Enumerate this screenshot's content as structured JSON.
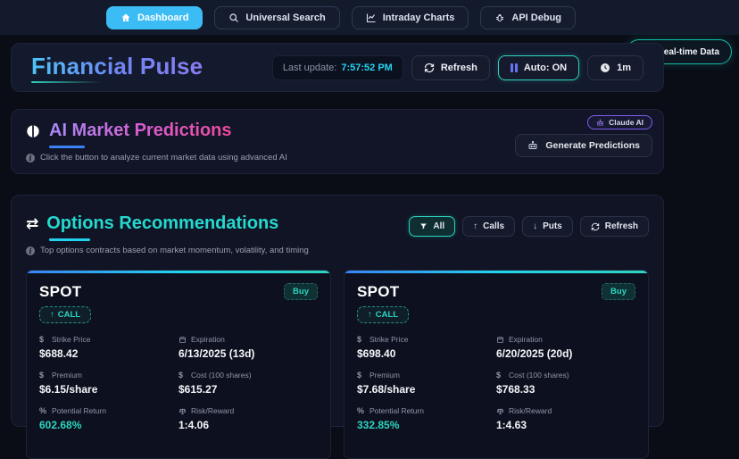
{
  "colors": {
    "accent_sky": "#3cbcf5",
    "accent_teal": "#2dd4bf",
    "accent_cyan": "#22d3ee",
    "accent_blue": "#3b82f6",
    "accent_purple": "#8b5cf6",
    "accent_pink": "#ec4899"
  },
  "navbar": {
    "items": [
      {
        "label": "Dashboard",
        "icon": "home-icon",
        "active": true
      },
      {
        "label": "Universal Search",
        "icon": "search-icon",
        "active": false
      },
      {
        "label": "Intraday Charts",
        "icon": "chart-line-icon",
        "active": false
      },
      {
        "label": "API Debug",
        "icon": "bug-icon",
        "active": false
      }
    ]
  },
  "realtime_badge": {
    "label": "Real-time Data",
    "icon": "check-circle-icon"
  },
  "header": {
    "title": "Financial Pulse",
    "last_update": {
      "label": "Last update:",
      "time": "7:57:52 PM"
    },
    "buttons": {
      "refresh": "Refresh",
      "auto": "Auto: ON",
      "interval": "1m"
    }
  },
  "ai_predictions": {
    "title": "AI Market Predictions",
    "subtitle": "Click the button to analyze current market data using advanced AI",
    "provider_badge": "Claude AI",
    "generate_button": "Generate Predictions"
  },
  "options": {
    "title": "Options Recommendations",
    "subtitle": "Top options contracts based on market momentum, volatility, and timing",
    "filters": [
      {
        "label": "All",
        "icon": "filter-icon",
        "active": true
      },
      {
        "label": "Calls",
        "icon": "arrow-up-icon",
        "active": false
      },
      {
        "label": "Puts",
        "icon": "arrow-down-icon",
        "active": false
      },
      {
        "label": "Refresh",
        "icon": "refresh-icon",
        "active": false
      }
    ],
    "cards": [
      {
        "symbol": "SPOT",
        "action": "Buy",
        "contract_type": "CALL",
        "fields": [
          {
            "label": "Strike Price",
            "value": "$688.42",
            "icon": "dollar-icon"
          },
          {
            "label": "Expiration",
            "value": "6/13/2025 (13d)",
            "icon": "calendar-icon"
          },
          {
            "label": "Premium",
            "value": "$6.15/share",
            "icon": "dollar-icon"
          },
          {
            "label": "Cost (100 shares)",
            "value": "$615.27",
            "icon": "dollar-icon"
          },
          {
            "label": "Potential Return",
            "value": "602.68%",
            "icon": "percent-icon",
            "highlight": true
          },
          {
            "label": "Risk/Reward",
            "value": "1:4.06",
            "icon": "scale-icon"
          }
        ]
      },
      {
        "symbol": "SPOT",
        "action": "Buy",
        "contract_type": "CALL",
        "fields": [
          {
            "label": "Strike Price",
            "value": "$698.40",
            "icon": "dollar-icon"
          },
          {
            "label": "Expiration",
            "value": "6/20/2025 (20d)",
            "icon": "calendar-icon"
          },
          {
            "label": "Premium",
            "value": "$7.68/share",
            "icon": "dollar-icon"
          },
          {
            "label": "Cost (100 shares)",
            "value": "$768.33",
            "icon": "dollar-icon"
          },
          {
            "label": "Potential Return",
            "value": "332.85%",
            "icon": "percent-icon",
            "highlight": true
          },
          {
            "label": "Risk/Reward",
            "value": "1:4.63",
            "icon": "scale-icon"
          }
        ]
      }
    ]
  }
}
